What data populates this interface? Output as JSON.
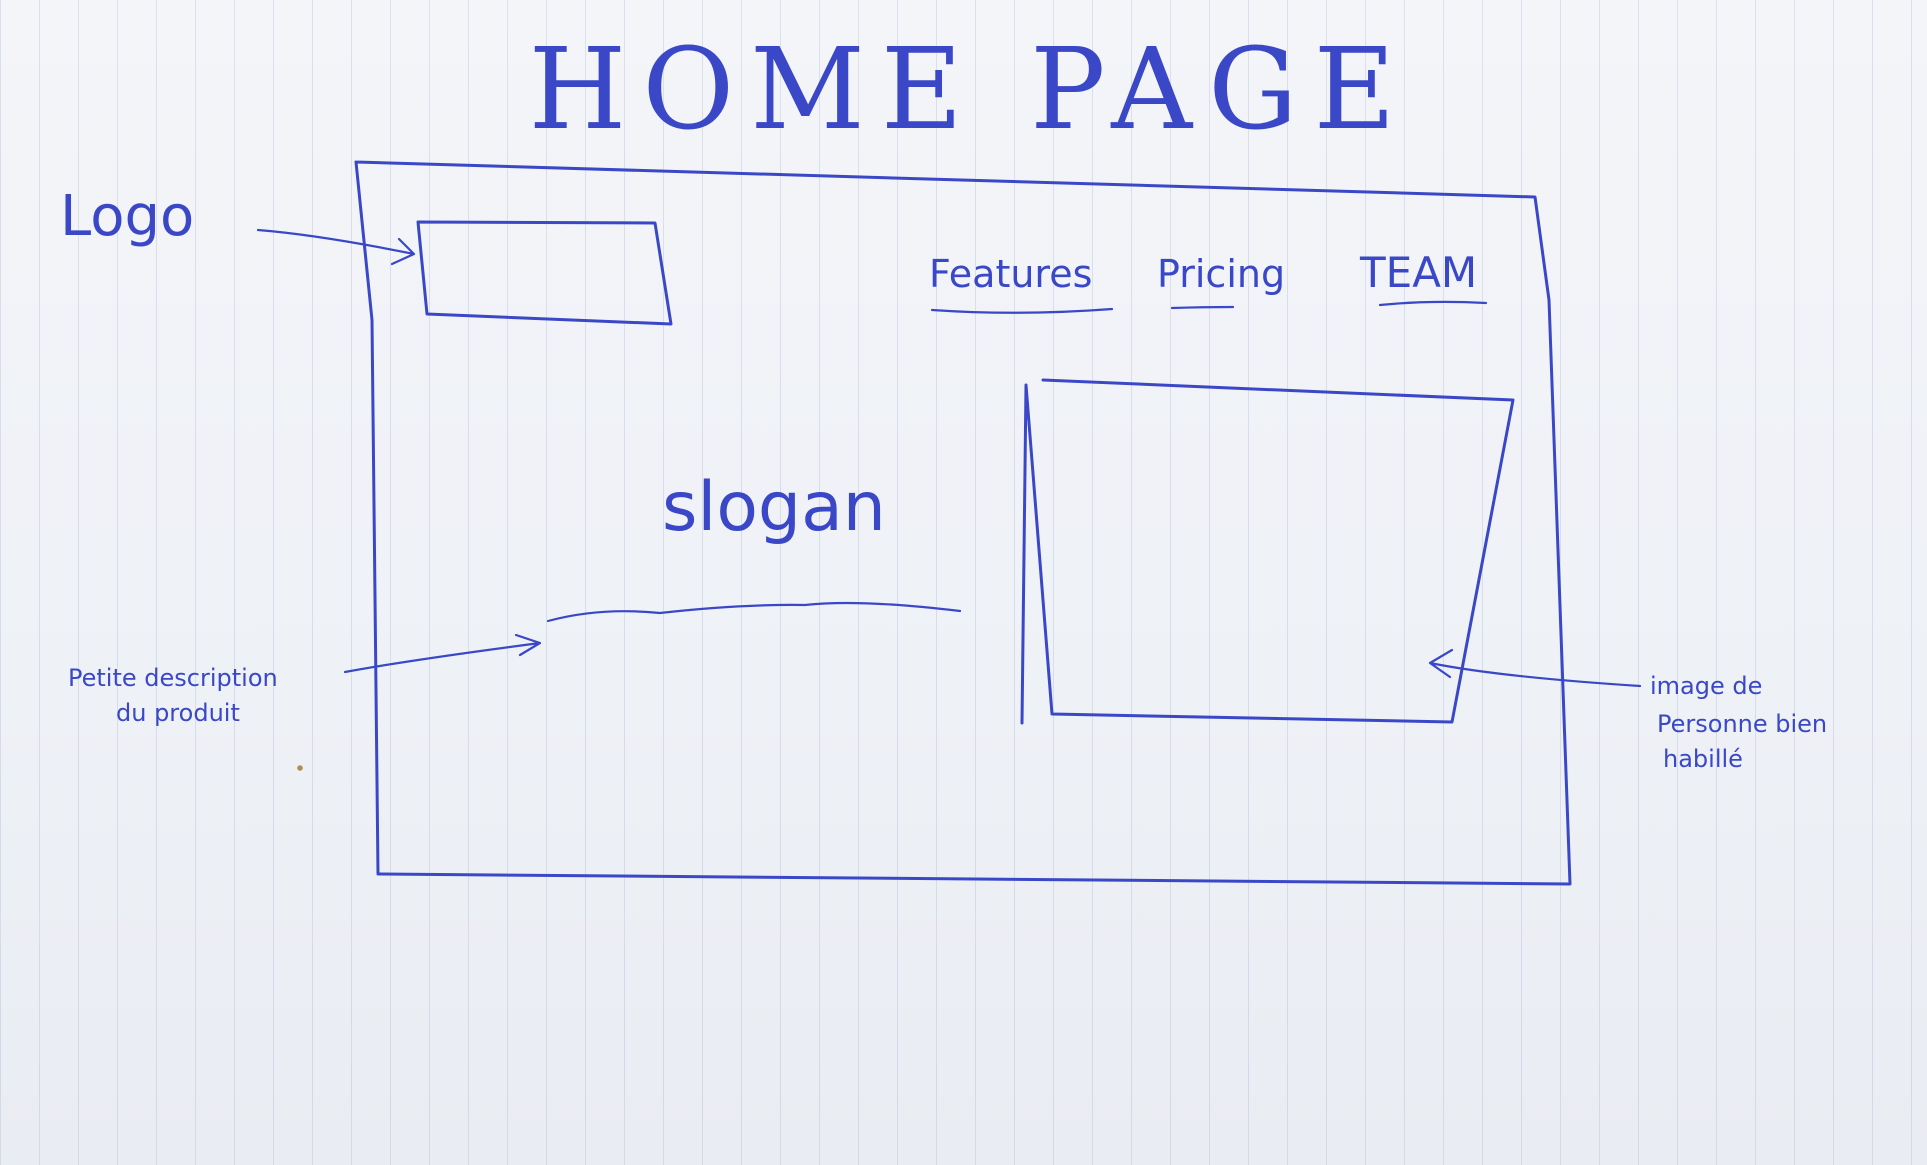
{
  "title": "HOME PAGE",
  "nav": {
    "features": "Features",
    "pricing": "Pricing",
    "team": "TEAM"
  },
  "hero": {
    "slogan": "slogan"
  },
  "annotations": {
    "logo": "Logo",
    "description_line1": "Petite description",
    "description_line2": "du produit",
    "image_line1": "image de",
    "image_line2": "Personne bien",
    "image_line3": "habillé"
  },
  "colors": {
    "ink": "#3a48c8",
    "paper": "#f2f4f8"
  }
}
